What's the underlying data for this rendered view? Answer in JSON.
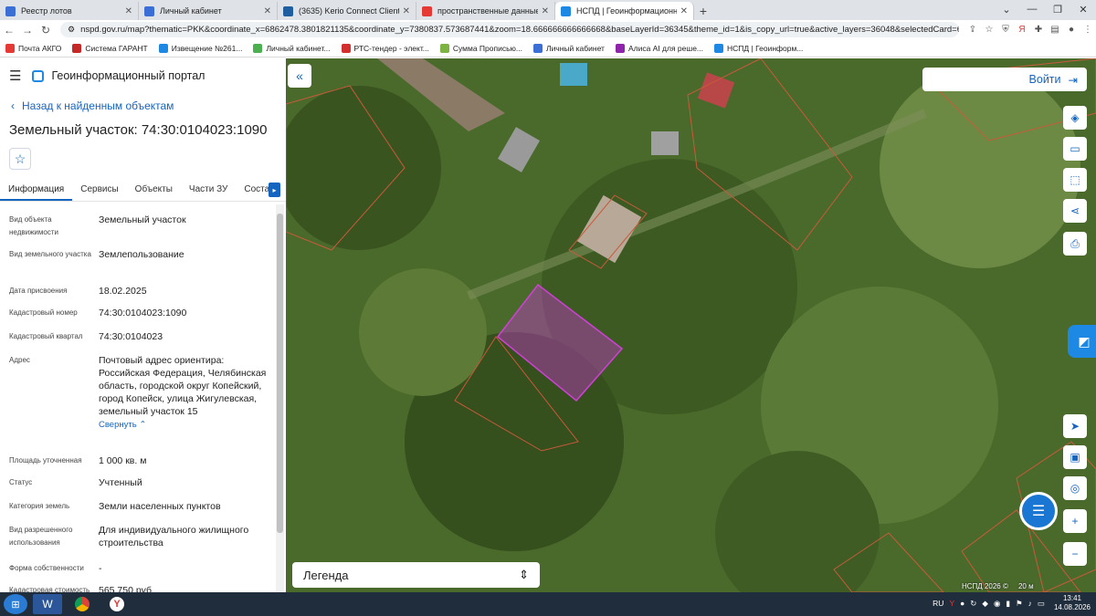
{
  "browser": {
    "tabs": [
      {
        "title": "Реестр лотов",
        "color": "#3b6fd6",
        "active": false
      },
      {
        "title": "Личный кабинет",
        "color": "#3b6fd6",
        "active": false
      },
      {
        "title": "(3635) Kerio Connect Client",
        "color": "#1f5fa0",
        "active": false
      },
      {
        "title": "пространственные данные росс",
        "color": "#e53935",
        "active": false
      },
      {
        "title": "НСПД | Геоинформационный п",
        "color": "#1e88e5",
        "active": true
      }
    ],
    "url": "nspd.gov.ru/map?thematic=PKK&coordinate_x=6862478.3801821135&coordinate_y=7380837.573687441&zoom=18.666666666666668&baseLayerId=36345&theme_id=1&is_copy_url=true&active_layers=36048&selectedCard=647680886%2...",
    "bookmarks": [
      {
        "label": "Почта АКГО",
        "color": "#e53935"
      },
      {
        "label": "Система ГАРАНТ",
        "color": "#c62828"
      },
      {
        "label": "Извещение №261...",
        "color": "#1e88e5"
      },
      {
        "label": "Личный кабинет...",
        "color": "#4caf50"
      },
      {
        "label": "РТС-тендер - элект...",
        "color": "#d32f2f"
      },
      {
        "label": "Сумма Прописью...",
        "color": "#7cb342"
      },
      {
        "label": "Личный кабинет",
        "color": "#3b6fd6"
      },
      {
        "label": "Алиса AI для реше...",
        "color": "#8e24aa"
      },
      {
        "label": "НСПД | Геоинформ...",
        "color": "#1e88e5"
      }
    ]
  },
  "sidebar": {
    "portal": "Геоинформационный портал",
    "back": "Назад к найденным объектам",
    "title": "Земельный участок: 74:30:0104023:1090",
    "tabs": [
      "Информация",
      "Сервисы",
      "Объекты",
      "Части ЗУ",
      "Состав"
    ],
    "rows": [
      {
        "label": "Вид объекта недвижимости",
        "value": "Земельный участок"
      },
      {
        "label": "Вид земельного участка",
        "value": "Землепользование"
      },
      {
        "label": "Дата присвоения",
        "value": "18.02.2025"
      },
      {
        "label": "Кадастровый номер",
        "value": "74:30:0104023:1090"
      },
      {
        "label": "Кадастровый квартал",
        "value": "74:30:0104023"
      },
      {
        "label": "Адрес",
        "value": "Почтовый адрес ориентира: Российская Федерация, Челябинская область, городской округ Копейский, город Копейск, улица Жигулевская, земельный участок 15",
        "link": "Свернуть"
      },
      {
        "label": "Площадь уточненная",
        "value": "1 000 кв. м"
      },
      {
        "label": "Статус",
        "value": "Учтенный"
      },
      {
        "label": "Категория земель",
        "value": "Земли населенных пунктов"
      },
      {
        "label": "Вид разрешенного использования",
        "value": "Для индивидуального жилищного строительства"
      },
      {
        "label": "Форма собственности",
        "value": "-"
      },
      {
        "label": "Кадастровая стоимость",
        "value": "565 750 руб."
      }
    ]
  },
  "map": {
    "login": "Войти",
    "legend": "Легенда",
    "attribution": "НСПД 2026 ©",
    "scale": "20 м",
    "highlight_color": "#c238c8"
  },
  "taskbar": {
    "lang": "RU",
    "time": "13:41",
    "date": "14.08.2026"
  }
}
